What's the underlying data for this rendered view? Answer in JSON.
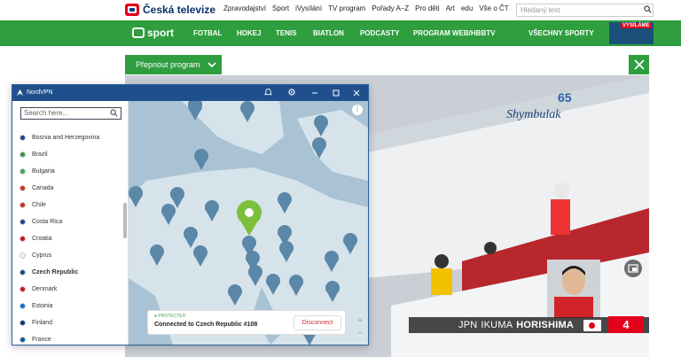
{
  "header": {
    "brand": "Česká televize",
    "nav": [
      "Zpravodajství",
      "Sport",
      "iVysílání",
      "TV program",
      "Pořady A–Z",
      "Pro děti",
      "Art",
      "edu",
      "Vše o ČT"
    ],
    "search_placeholder": "Hledaný text"
  },
  "sport_bar": {
    "brand": "sport",
    "nav": [
      "FOTBAL",
      "HOKEJ",
      "TENIS",
      "BIATLON",
      "PODCASTY",
      "PROGRAM WEB/HBBTV",
      "VŠECHNY SPORTY"
    ],
    "live_badge": "VYSÍLÁME",
    "accent": "#2f9e3f"
  },
  "player": {
    "switch_program_label": "Přepnout program",
    "lower_third_country": "JPN",
    "lower_third_first": "IKUMA",
    "lower_third_last": "HORISHIMA",
    "rank": "4"
  },
  "vpn": {
    "title": "NordVPN",
    "search_placeholder": "Search here...",
    "countries": [
      {
        "name": "Bosnia and Herzegovina",
        "color": "#1c3f94"
      },
      {
        "name": "Brazil",
        "color": "#2b9a3a"
      },
      {
        "name": "Bulgaria",
        "color": "#3aa54a"
      },
      {
        "name": "Canada",
        "color": "#d52b1e"
      },
      {
        "name": "Chile",
        "color": "#d52b1e"
      },
      {
        "name": "Costa Rica",
        "color": "#1c3f94"
      },
      {
        "name": "Croatia",
        "color": "#c8102e"
      },
      {
        "name": "Cyprus",
        "color": "#f0f0f0"
      },
      {
        "name": "Czech Republic",
        "color": "#11457e"
      },
      {
        "name": "Denmark",
        "color": "#c8102e"
      },
      {
        "name": "Estonia",
        "color": "#0072ce"
      },
      {
        "name": "Finland",
        "color": "#003580"
      },
      {
        "name": "France",
        "color": "#0055a4"
      }
    ],
    "selected_country": "Czech Republic",
    "status_label": "● PROTECTED",
    "connected_text": "Connected to Czech Republic #108",
    "disconnect_label": "Disconnect",
    "menu_glyph": "⋮",
    "zoom_in": "+",
    "zoom_out": "−"
  }
}
